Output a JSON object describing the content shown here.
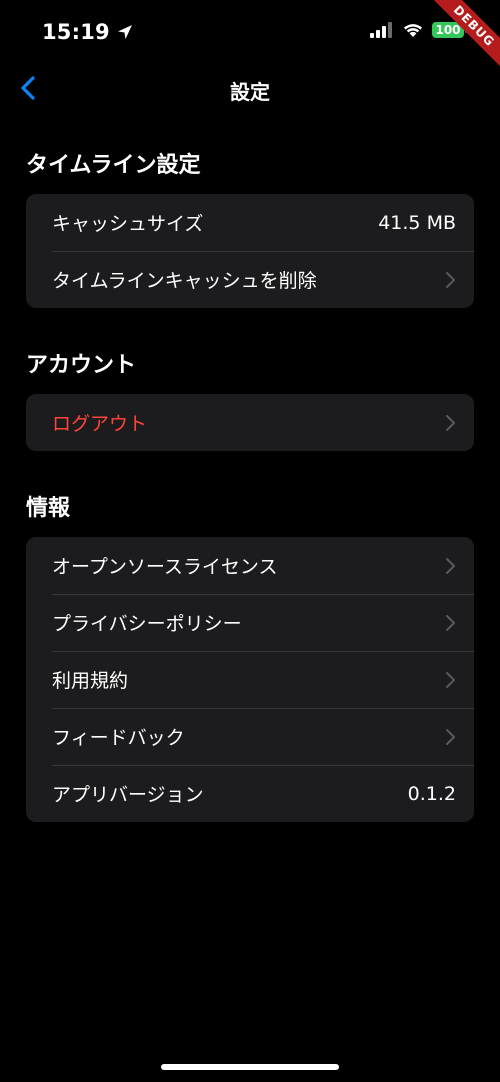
{
  "status_bar": {
    "time": "15:19",
    "battery": "100",
    "debug_label": "DEBUG"
  },
  "nav": {
    "title": "設定"
  },
  "sections": {
    "timeline": {
      "title": "タイムライン設定",
      "cache_size_label": "キャッシュサイズ",
      "cache_size_value": "41.5 MB",
      "clear_cache_label": "タイムラインキャッシュを削除"
    },
    "account": {
      "title": "アカウント",
      "logout_label": "ログアウト"
    },
    "info": {
      "title": "情報",
      "oss_label": "オープンソースライセンス",
      "privacy_label": "プライバシーポリシー",
      "terms_label": "利用規約",
      "feedback_label": "フィードバック",
      "version_label": "アプリバージョン",
      "version_value": "0.1.2"
    }
  },
  "colors": {
    "background": "#000000",
    "group_background": "#1c1c1e",
    "accent": "#0a84ff",
    "danger": "#ff453a",
    "chevron": "#5a5a5e",
    "battery": "#35c759",
    "debug": "#b71c1c"
  }
}
